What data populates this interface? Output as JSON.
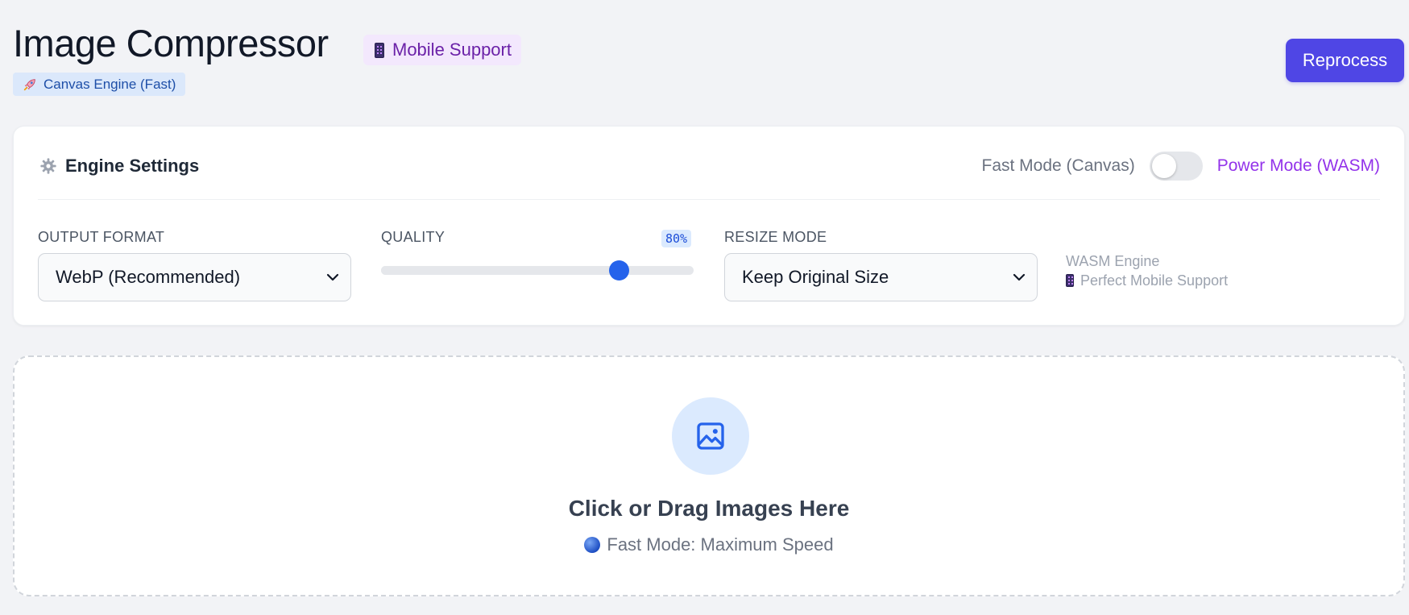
{
  "header": {
    "title": "Image Compressor",
    "mobile_badge": "Mobile Support",
    "engine_badge": "Canvas Engine (Fast)",
    "reprocess_label": "Reprocess"
  },
  "settings": {
    "title": "Engine Settings",
    "fast_mode_label": "Fast Mode (Canvas)",
    "power_mode_label": "Power Mode (WASM)",
    "power_mode_enabled": false,
    "output_format": {
      "label": "OUTPUT FORMAT",
      "selected": "WebP (Recommended)"
    },
    "quality": {
      "label": "QUALITY",
      "value_text": "80%",
      "value": 0.8
    },
    "resize_mode": {
      "label": "RESIZE MODE",
      "selected": "Keep Original Size"
    },
    "wasm_info": {
      "line1": "WASM Engine",
      "line2": "Perfect Mobile Support"
    }
  },
  "dropzone": {
    "title": "Click or Drag Images Here",
    "subtitle": "Fast Mode: Maximum Speed"
  },
  "colors": {
    "accent": "#4f46e5",
    "slider_thumb": "#2563eb",
    "power_mode": "#9333ea"
  },
  "icons": {
    "mobile": "mobile-phone-icon",
    "engine": "rocket-icon",
    "settings": "gear-icon",
    "dropzone": "image-icon",
    "subtitle": "globe-icon",
    "select": "chevron-down-icon"
  }
}
